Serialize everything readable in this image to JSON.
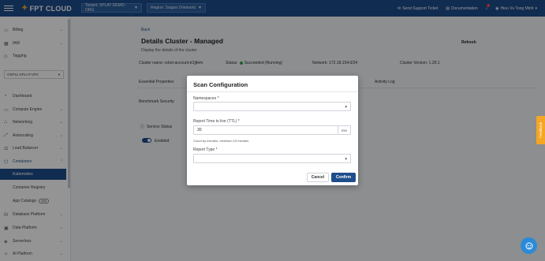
{
  "topbar": {
    "logo": "FPT CLOUD",
    "tenant": "Tenant: XPLAT-DEMO-ORG",
    "region": "Region: Saigon (Vietnam)",
    "support": "Send Support Ticket",
    "documentation": "Documentation",
    "notification_count": "1",
    "user": "Hieu Vu Tong Minh"
  },
  "sidebar": {
    "items": [
      {
        "label": "Billing"
      },
      {
        "label": "IAM"
      },
      {
        "label": "Tagging"
      }
    ],
    "vpc": "OSP11-XPLAT-VPC",
    "nav": [
      {
        "label": "Dashboard"
      },
      {
        "label": "Compute Engine"
      },
      {
        "label": "Networking"
      },
      {
        "label": "Autoscaling"
      },
      {
        "label": "Load Balancer"
      },
      {
        "label": "Containers"
      },
      {
        "label": "Kubernetes"
      },
      {
        "label": "Container Registry"
      },
      {
        "label": "App Catalogs"
      },
      {
        "label": "Database Platform"
      },
      {
        "label": "Data Platform"
      },
      {
        "label": "Serverless"
      },
      {
        "label": "AI Platform"
      }
    ],
    "beta": "beta"
  },
  "main": {
    "back": "Back",
    "title": "Details Cluster - Managed",
    "subtitle": "Display the details of the cluster",
    "refresh": "Refresh",
    "cluster_name": "Cluster name: robot-account-tr2jjfem",
    "status_label": "Status:",
    "status_value": "Succeeded (Running)",
    "network": "Network: 172.18.154.0/24",
    "version": "Cluster Version: 1.29.1",
    "tab_properties": "Essential Properties",
    "tab_activity": "Activity Log",
    "section": "Benchmark Security",
    "service_status": "Service Status",
    "enabled": "Enabled"
  },
  "feedback": "Feedback",
  "modal": {
    "title": "Scan Configuration",
    "namespaces_label": "Namespaces",
    "ttl_label": "Report Time to live (TTL)",
    "ttl_value": "30",
    "ttl_unit": "min",
    "ttl_hint": "Count by minutes, minimum 15 minutes",
    "report_type_label": "Report Type",
    "required": "*",
    "cancel": "Cancel",
    "confirm": "Confirm"
  }
}
